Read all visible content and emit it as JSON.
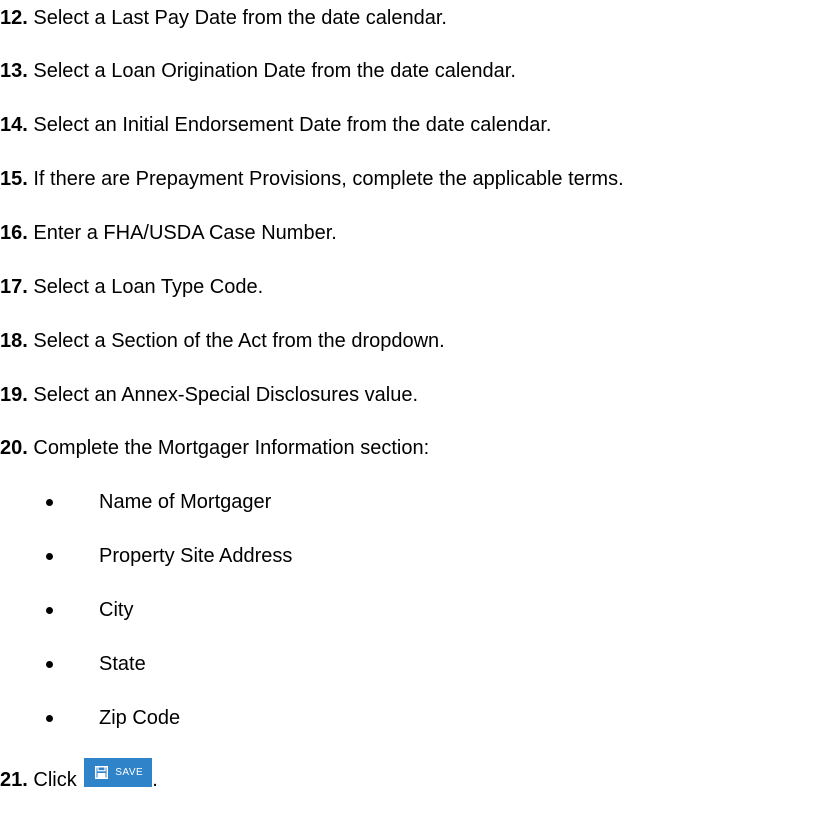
{
  "steps": [
    {
      "num": "12.",
      "text": " Select a Last Pay Date from the date calendar."
    },
    {
      "num": "13.",
      "text": " Select a Loan Origination Date from the date calendar."
    },
    {
      "num": "14.",
      "text": " Select an Initial Endorsement Date from the date calendar."
    },
    {
      "num": "15.",
      "text": " If there are Prepayment Provisions, complete the applicable terms."
    },
    {
      "num": "16.",
      "text": " Enter a FHA/USDA Case Number."
    },
    {
      "num": "17.",
      "text": " Select a Loan Type Code."
    },
    {
      "num": "18.",
      "text": " Select a Section of the Act from the dropdown."
    },
    {
      "num": "19.",
      "text": " Select an Annex-Special Disclosures value."
    },
    {
      "num": "20.",
      "text": " Complete the Mortgager Information section:"
    }
  ],
  "bullets": [
    "Name of Mortgager",
    "Property Site Address",
    "City",
    "State",
    "Zip Code"
  ],
  "final_step": {
    "num": "21.",
    "text": " Click ",
    "after": "."
  },
  "save_button": {
    "label": "SAVE",
    "icon": "floppy-disk-icon",
    "color": "#2f83c9"
  }
}
